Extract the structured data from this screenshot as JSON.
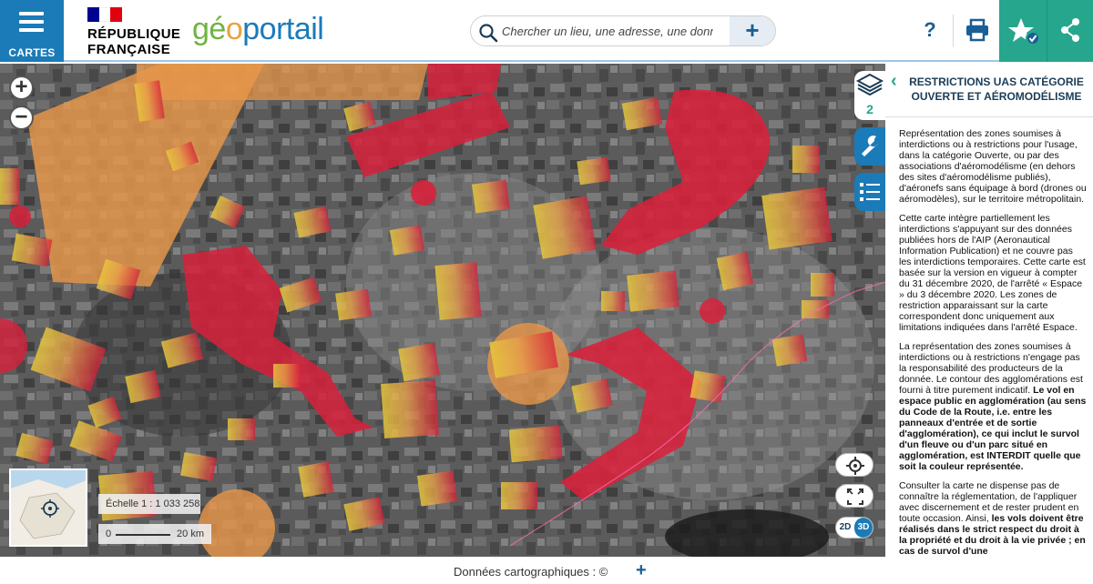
{
  "header": {
    "menu_label": "CARTES",
    "republic_line1": "RÉPUBLIQUE",
    "republic_line2": "FRANÇAISE",
    "logo_part1": "gé",
    "logo_part2": "o",
    "logo_part3": "portail",
    "search_placeholder": "Chercher un lieu, une adresse, une donnée",
    "search_add": "+",
    "help_label": "?",
    "colors": {
      "menu": "#1b7bb8",
      "accent": "#26a78d",
      "flag_blue": "#000091",
      "flag_red": "#e1000f"
    }
  },
  "map": {
    "zoom_in": "+",
    "zoom_out": "−",
    "layers_count": "2",
    "scale_text": "Échelle 1 : 1 033 258",
    "scale_start": "0",
    "scale_end": "20 km",
    "mode_2d": "2D",
    "mode_3d": "3D",
    "zone_colors": {
      "red": "#d8213b",
      "orange": "#e8974a",
      "yellow": "#e8c93c"
    }
  },
  "panel": {
    "title": "RESTRICTIONS UAS CATÉGORIE OUVERTE ET AÉROMODÉLISME",
    "p1": "Représentation des zones soumises à interdictions ou à restrictions pour l'usage, dans la catégorie Ouverte, ou par des associations d'aéromodélisme (en dehors des sites d'aéromodélisme publiés), d'aéronefs sans équipage à bord (drones ou aéromodèles), sur le territoire métropolitain.",
    "p2": "Cette carte intègre partiellement les interdictions s'appuyant sur des données publiées hors de l'AIP (Aeronautical Information Publication) et ne couvre pas les interdictions temporaires. Cette carte est basée sur la version en vigueur à compter du 31 décembre 2020, de l'arrêté « Espace » du 3 décembre 2020. Les zones de restriction apparaissant sur la carte correspondent donc uniquement aux limitations indiquées dans l'arrêté Espace.",
    "p3a": "La représentation des zones soumises à interdictions ou à restrictions n'engage pas la responsabilité des producteurs de la donnée. Le contour des agglomérations est fourni à titre purement indicatif.",
    "p3b": "Le vol en espace public en agglomération (au sens du Code de la Route, i.e. entre les panneaux d'entrée et de sortie d'agglomération), ce qui inclut le survol d'un fleuve ou d'un parc situé en agglomération, est INTERDIT quelle que soit la couleur représentée.",
    "p4a": "Consulter la carte ne dispense pas de connaître la réglementation, de l'appliquer avec discernement et de rester prudent en toute occasion. Ainsi,",
    "p4b": "les vols doivent être réalisés dans le strict respect du droit à la propriété et du droit à la vie privée ; en cas de survol d'une"
  },
  "footer": {
    "text": "Données cartographiques : ©",
    "plus": "+"
  }
}
